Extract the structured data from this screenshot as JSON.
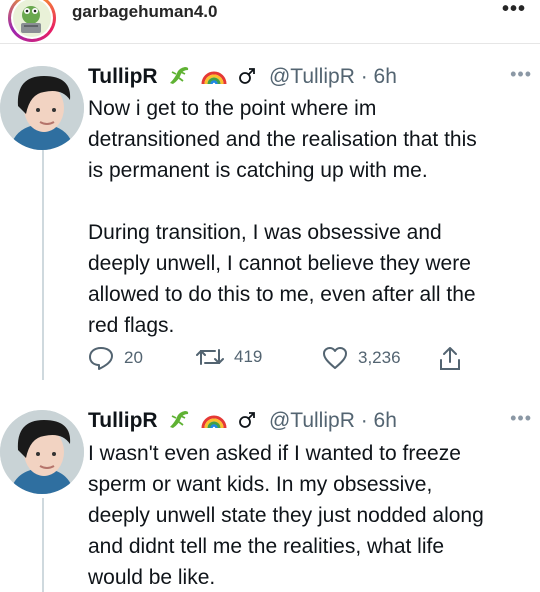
{
  "post_header": {
    "username": "garbagehuman4.0",
    "more_icon": "ellipsis-icon"
  },
  "tweets": [
    {
      "display_name": "TullipR",
      "emojis": [
        "lizard-icon",
        "rainbow-icon",
        "male-sign-icon"
      ],
      "handle_time": "@TullipR · 6h",
      "text": "Now i get to the point where im\ndetransitioned and the realisation that this\nis permanent is catching up with me.\n\nDuring transition, I was obsessive and\ndeeply unwell, I cannot believe they were\nallowed to do this to me, even after all the\nred flags.",
      "replies": "20",
      "retweets": "419",
      "likes": "3,236"
    },
    {
      "display_name": "TullipR",
      "emojis": [
        "lizard-icon",
        "rainbow-icon",
        "male-sign-icon"
      ],
      "handle_time": "@TullipR · 6h",
      "text": "I wasn't even asked if I wanted to freeze\nsperm or want kids. In my obsessive,\ndeeply unwell state they just nodded along\nand didnt tell me the realities, what life\nwould be like."
    }
  ],
  "colors": {
    "text": "#0f1419",
    "secondary": "#536471",
    "thread_line": "#cfd9de"
  }
}
